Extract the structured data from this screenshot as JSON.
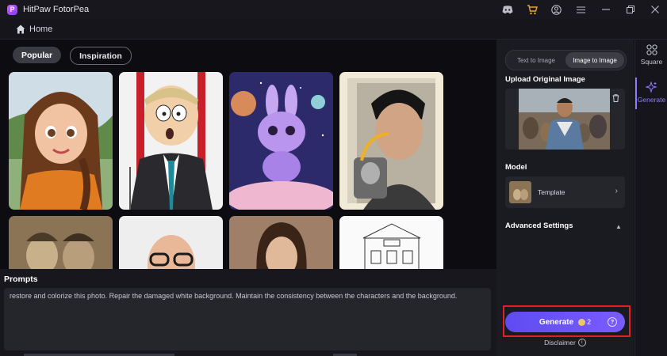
{
  "window": {
    "title": "HitPaw FotorPea",
    "logo_letter": "P"
  },
  "nav": {
    "home_label": "Home"
  },
  "gallery": {
    "filters": [
      {
        "label": "Popular",
        "active": true
      },
      {
        "label": "Inspiration",
        "active": false
      }
    ]
  },
  "prompts": {
    "title": "Prompts",
    "text": "restore and colorize this photo. Repair the damaged white background. Maintain the consistency between the characters and the background."
  },
  "panel": {
    "tabs": [
      {
        "label": "Text to Image",
        "active": false
      },
      {
        "label": "Image to Image",
        "active": true
      }
    ],
    "upload_title": "Upload Original Image",
    "model_title": "Model",
    "model_value": "Template",
    "advanced_title": "Advanced Settings",
    "generate_label": "Generate",
    "generate_cost": "2",
    "disclaimer": "Disclaimer"
  },
  "sidebar": {
    "items": [
      {
        "label": "Square"
      },
      {
        "label": "Generate"
      }
    ]
  },
  "colors": {
    "accent": "#7a5cff",
    "highlight": "#e0202a"
  }
}
